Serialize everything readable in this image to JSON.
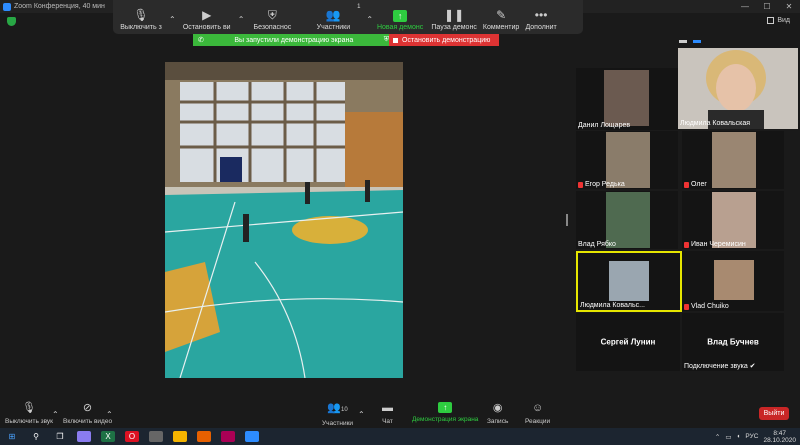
{
  "window": {
    "title": "Zoom Конференция, 40 мин",
    "minimize": "—",
    "maximize": "☐",
    "close": "✕"
  },
  "view_label": "Вид",
  "share_toolbar": {
    "items": [
      {
        "label": "Выключить з",
        "icon": "microphone-icon"
      },
      {
        "label": "Остановить ви",
        "icon": "video-camera-icon"
      },
      {
        "label": "Безопаснос",
        "icon": "shield-icon"
      },
      {
        "label": "Участники",
        "icon": "participants-icon",
        "count": "1"
      },
      {
        "label": "Новая демонс",
        "icon": "share-screen-icon"
      },
      {
        "label": "Пауза демонс",
        "icon": "pause-icon"
      },
      {
        "label": "Комментир",
        "icon": "pencil-icon"
      },
      {
        "label": "Дополнит",
        "icon": "more-icon"
      }
    ]
  },
  "share_notice": {
    "text": "Вы запустили демонстрацию экрана",
    "stop": "Остановить демонстрацию"
  },
  "participants": [
    {
      "name": "Данил Лощарев",
      "muted": false
    },
    {
      "name": "Людмила Ковальская",
      "muted": false,
      "speaker": true
    },
    {
      "name": "Егор Редька",
      "muted": true
    },
    {
      "name": "Олег",
      "muted": true
    },
    {
      "name": "Влад Рябко",
      "muted": false
    },
    {
      "name": "Иван Черемисин",
      "muted": true
    },
    {
      "name": "Людмила Ковальс...",
      "muted": false,
      "active": true
    },
    {
      "name": "Vlad Chuiko",
      "muted": true
    },
    {
      "name": "Сергей Лунин",
      "muted": false
    },
    {
      "name": "Влад Бучнев",
      "muted": false,
      "status": "Подключение звука ✔"
    }
  ],
  "bottom_toolbar": {
    "items": [
      {
        "label": "Выключить звук",
        "icon": "microphone-icon"
      },
      {
        "label": "Включить видео",
        "icon": "video-off-icon"
      },
      {
        "label": "Участники",
        "icon": "participants-icon",
        "count": "10"
      },
      {
        "label": "Чат",
        "icon": "chat-icon"
      },
      {
        "label": "Демонстрация экрана",
        "icon": "share-screen-icon"
      },
      {
        "label": "Запись",
        "icon": "record-icon"
      },
      {
        "label": "Реакции",
        "icon": "reactions-icon"
      }
    ],
    "leave": "Выйти"
  },
  "taskbar": {
    "lang": "РУС",
    "time": "8:47",
    "date": "28.10.2020"
  },
  "colors": {
    "green": "#2ecc40",
    "red": "#d33333",
    "yellow": "#e6e600"
  }
}
